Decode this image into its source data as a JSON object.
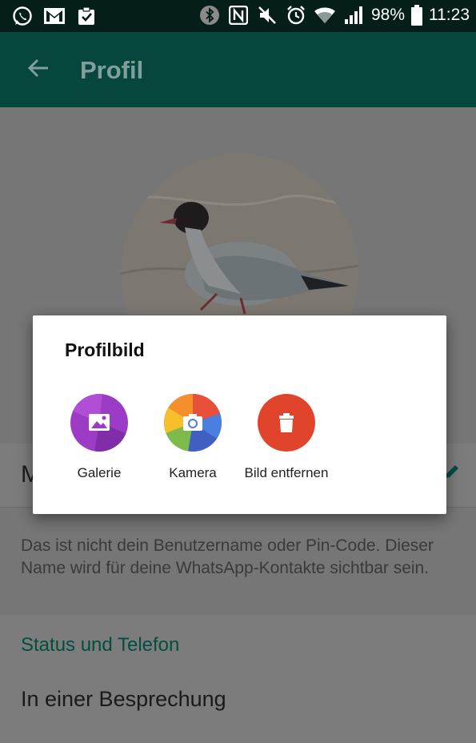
{
  "status_bar": {
    "left_icons": [
      "whatsapp-icon",
      "gmail-icon",
      "clipboard-check-icon"
    ],
    "right_icons": [
      "bluetooth-icon",
      "nfc-icon",
      "mute-icon",
      "alarm-icon",
      "wifi-icon",
      "signal-icon"
    ],
    "battery": "98%",
    "time": "11:23"
  },
  "app_bar": {
    "back_icon": "arrow-left-icon",
    "title": "Profil"
  },
  "profile": {
    "name_initial": "M",
    "edit_icon": "pencil-icon",
    "hint": "Das ist nicht dein Benutzername oder Pin-Code. Dieser Name wird für deine WhatsApp-Kontakte sichtbar sein."
  },
  "status_section": {
    "heading": "Status und Telefon",
    "value": "In einer Besprechung"
  },
  "dialog": {
    "title": "Profilbild",
    "options": [
      {
        "label": "Galerie",
        "icon": "gallery-icon",
        "color": "#9c3cc6"
      },
      {
        "label": "Kamera",
        "icon": "camera-icon",
        "color": "#4a7ee0"
      },
      {
        "label": "Bild entfernen",
        "icon": "trash-icon",
        "color": "#e0452b"
      }
    ]
  },
  "colors": {
    "status_bar": "#051e1a",
    "app_bar": "#07463d",
    "accent": "#034d42",
    "scrim": "#767676"
  }
}
